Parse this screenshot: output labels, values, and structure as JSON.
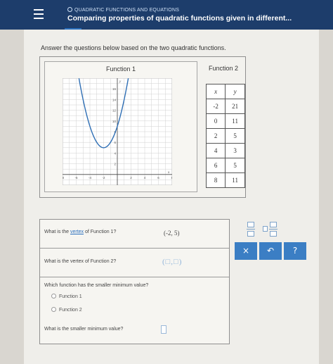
{
  "header": {
    "topic": "QUADRATIC FUNCTIONS AND EQUATIONS",
    "title": "Comparing properties of quadratic functions given in different..."
  },
  "instructions": "Answer the questions below based on the two quadratic functions.",
  "function1": {
    "label": "Function 1",
    "graph": {
      "axis_label_y": "y",
      "axis_label_x": "x",
      "x_range": [
        -8,
        8
      ],
      "y_range": [
        -2,
        18
      ],
      "y_ticks": [
        "16",
        "14",
        "12",
        "10",
        "8",
        "6",
        "4",
        "2"
      ],
      "x_ticks": [
        "-8",
        "-6",
        "-4",
        "-2",
        "2",
        "4",
        "6",
        "8"
      ],
      "vertex": [
        -2,
        5
      ]
    }
  },
  "function2": {
    "label": "Function 2",
    "headers": [
      "x",
      "y"
    ],
    "rows": [
      [
        "-2",
        "21"
      ],
      [
        "0",
        "11"
      ],
      [
        "2",
        "5"
      ],
      [
        "4",
        "3"
      ],
      [
        "6",
        "5"
      ],
      [
        "8",
        "11"
      ]
    ]
  },
  "questions": {
    "q1": {
      "prefix": "What is the ",
      "link": "vertex",
      "suffix": " of Function 1?",
      "answer": "(-2, 5)"
    },
    "q2": {
      "text": "What is the vertex of Function 2?",
      "input_value": "(□,□)"
    },
    "q3": {
      "text": "Which function has the smaller minimum value?",
      "option1": "Function 1",
      "option2": "Function 2",
      "followup": "What is the smaller minimum value?"
    }
  },
  "buttons": {
    "clear": "×",
    "undo": "↶",
    "help": "?"
  },
  "colors": {
    "header": "#1d3d6b",
    "accent": "#3b7ec4",
    "curve": "#2f6fb5"
  }
}
